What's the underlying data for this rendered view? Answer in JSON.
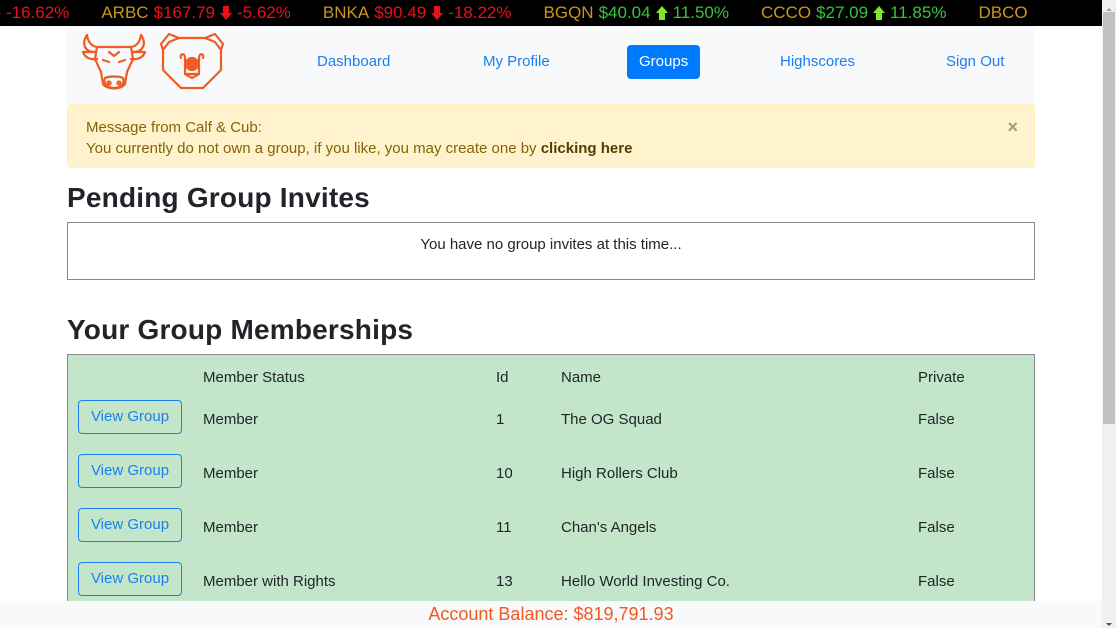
{
  "ticker": [
    {
      "symbol": "",
      "price": "",
      "change": "-16.62%",
      "direction": "down"
    },
    {
      "symbol": "ARBC",
      "price": "$167.79",
      "change": "-5.62%",
      "direction": "down"
    },
    {
      "symbol": "BNKA",
      "price": "$90.49",
      "change": "-18.22%",
      "direction": "down"
    },
    {
      "symbol": "BGQN",
      "price": "$40.04",
      "change": "11.50%",
      "direction": "up"
    },
    {
      "symbol": "CCCO",
      "price": "$27.09",
      "change": "11.85%",
      "direction": "up"
    },
    {
      "symbol": "DBCO",
      "price": "",
      "change": "",
      "direction": ""
    }
  ],
  "nav": {
    "logo_bull": "bull-logo",
    "logo_bear": "bear-logo",
    "items": [
      {
        "label": "Dashboard",
        "active": false
      },
      {
        "label": "My Profile",
        "active": false
      },
      {
        "label": "Groups",
        "active": true
      },
      {
        "label": "Highscores",
        "active": false
      },
      {
        "label": "Sign Out",
        "active": false
      }
    ]
  },
  "alert": {
    "title": "Message from Calf & Cub:",
    "body": "You currently do not own a group, if you like, you may create one by",
    "link": "clicking here",
    "close": "×"
  },
  "pending": {
    "heading": "Pending Group Invites",
    "empty_text": "You have no group invites at this time..."
  },
  "memberships": {
    "heading": "Your Group Memberships",
    "columns": [
      "",
      "Member Status",
      "Id",
      "Name",
      "Private"
    ],
    "button_label": "View Group",
    "rows": [
      {
        "status": "Member",
        "id": "1",
        "name": "The OG Squad",
        "private": "False"
      },
      {
        "status": "Member",
        "id": "10",
        "name": "High Rollers Club",
        "private": "False"
      },
      {
        "status": "Member",
        "id": "11",
        "name": "Chan's Angels",
        "private": "False"
      },
      {
        "status": "Member with Rights",
        "id": "13",
        "name": "Hello World Investing Co.",
        "private": "False"
      }
    ]
  },
  "footer": {
    "balance_label": "Account Balance: $819,791.93"
  },
  "colors": {
    "brand_orange": "#f05a23",
    "primary_blue": "#007bff",
    "ticker_down": "#e8101a",
    "ticker_up": "#36c43a",
    "ticker_symbol": "#c8961e",
    "table_bg": "#c3e6cb",
    "alert_bg": "#fff3cd"
  }
}
